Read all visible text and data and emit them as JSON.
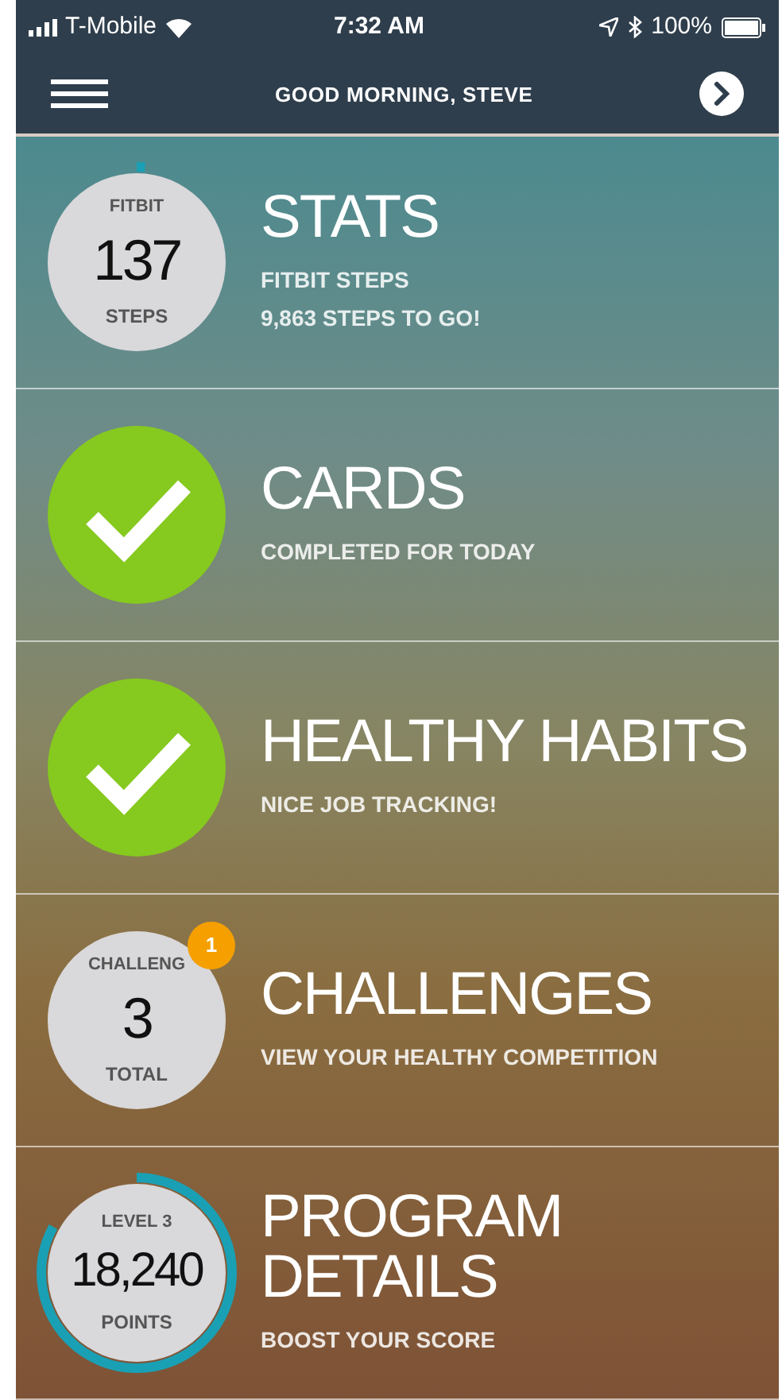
{
  "status_bar": {
    "carrier": "T-Mobile",
    "time": "7:32 AM",
    "battery": "100%"
  },
  "nav": {
    "title": "GOOD MORNING, STEVE"
  },
  "rows": [
    {
      "kind": "stat",
      "top": "FITBIT",
      "value": "137",
      "bottom": "STEPS",
      "level": 0.0137,
      "title": "STATS",
      "lines": [
        "FITBIT STEPS",
        "9,863 STEPS TO GO!"
      ]
    },
    {
      "kind": "check",
      "title": "CARDS",
      "lines": [
        "COMPLETED FOR TODAY"
      ]
    },
    {
      "kind": "check",
      "title": "HEALTHY HABITS",
      "lines": [
        "NICE JOB TRACKING!"
      ]
    },
    {
      "kind": "stat",
      "top": "CHALLENG",
      "value": "3",
      "bottom": "TOTAL",
      "badge": "1",
      "title": "CHALLENGES",
      "lines": [
        "VIEW YOUR HEALTHY COMPETITION"
      ]
    },
    {
      "kind": "stat",
      "top": "LEVEL 3",
      "value": "18,240",
      "bottom": "POINTS",
      "level": 0.83,
      "title": "PROGRAM DETAILS",
      "lines": [
        "BOOST YOUR SCORE"
      ]
    }
  ]
}
